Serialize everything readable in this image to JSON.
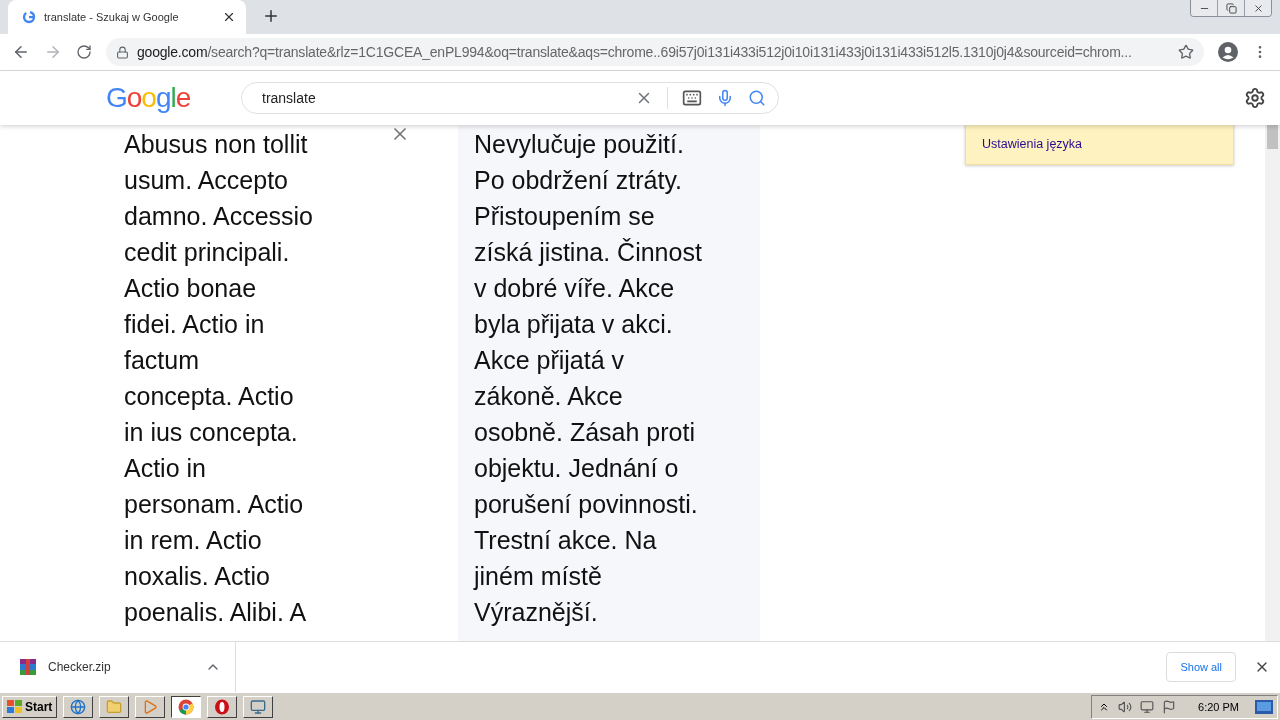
{
  "tab": {
    "title": "translate - Szukaj w Google",
    "selected": true
  },
  "address": {
    "host": "google.com",
    "path": "/search?q=translate&rlz=1C1GCEA_enPL994&oq=translate&aqs=chrome..69i57j0i131i433i512j0i10i131i433j0i131i433i512l5.1310j0j4&sourceid=chrom..."
  },
  "logo": "Google",
  "search": {
    "value": "translate"
  },
  "translation": {
    "source_lines": [
      "Abusus non tollit",
      "usum. Accepto",
      "damno. Accessio",
      "cedit principali.",
      "Actio bonae",
      "fidei. Actio in",
      "factum",
      "concepta. Actio",
      "in ius concepta.",
      "Actio in",
      "personam. Actio",
      "in rem. Actio",
      "noxalis. Actio",
      "poenalis. Alibi. A"
    ],
    "target_lines": [
      "Nevylučuje použití.",
      "Po obdržení ztráty.",
      "Přistoupením se",
      "získá jistina. Činnost",
      "v dobré víře. Akce",
      "byla přijata v akci.",
      "Akce přijatá v",
      "zákoně. Akce",
      "osobně. Zásah proti",
      "objektu. Jednání o",
      "porušení povinnosti.",
      "Trestní akce. Na",
      "jiném místě",
      "Výraznější."
    ]
  },
  "language_settings": "Ustawienia języka",
  "downloads": {
    "file": "Checker.zip",
    "show_all": "Show all"
  },
  "taskbar": {
    "start": "Start",
    "apps": [
      {
        "kind": "ie",
        "selected": false
      },
      {
        "kind": "explorer",
        "selected": false
      },
      {
        "kind": "media",
        "selected": false
      },
      {
        "kind": "chrome",
        "selected": true
      },
      {
        "kind": "opera",
        "selected": false
      },
      {
        "kind": "window",
        "selected": false
      }
    ],
    "clock": "6:20 PM"
  }
}
